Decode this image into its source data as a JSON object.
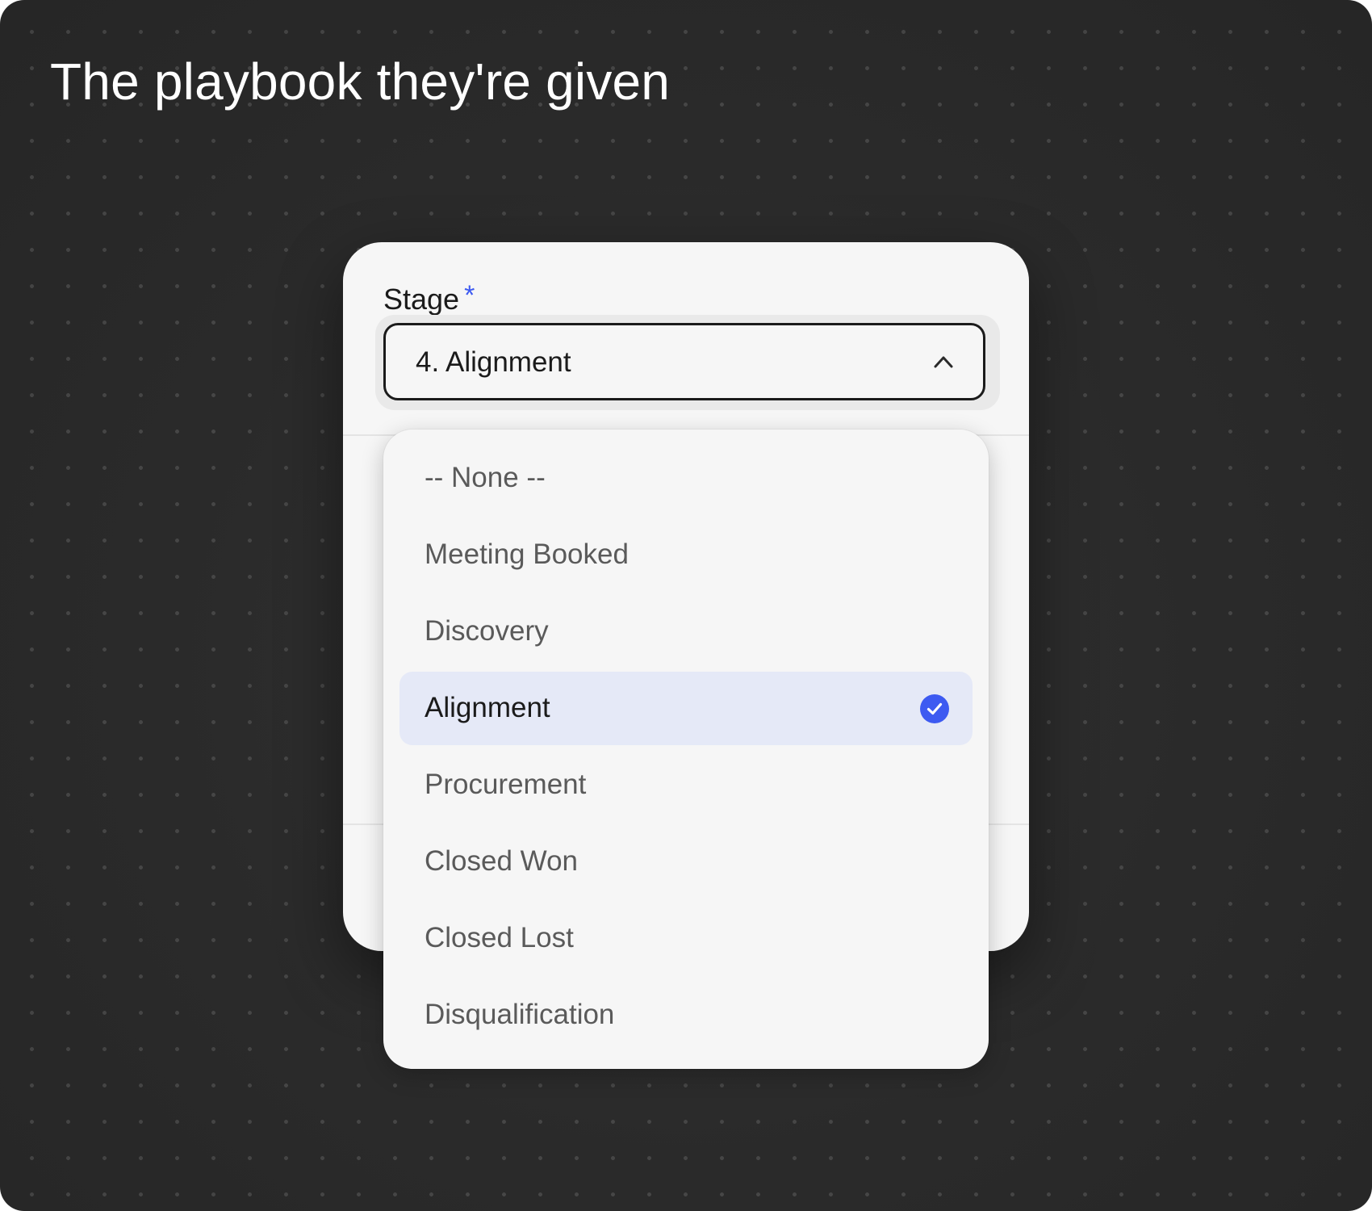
{
  "headline": "The playbook they're given",
  "form": {
    "field_label": "Stage",
    "required_mark": "*",
    "selected_value": "4. Alignment"
  },
  "dropdown": {
    "options": [
      {
        "label": "-- None --",
        "selected": false
      },
      {
        "label": "Meeting Booked",
        "selected": false
      },
      {
        "label": "Discovery",
        "selected": false
      },
      {
        "label": "Alignment",
        "selected": true
      },
      {
        "label": "Procurement",
        "selected": false
      },
      {
        "label": "Closed Won",
        "selected": false
      },
      {
        "label": "Closed Lost",
        "selected": false
      },
      {
        "label": "Disqualification",
        "selected": false
      }
    ]
  },
  "icons": {
    "select_toggle": "chevron-up-icon",
    "selected_marker": "check-circle-icon"
  },
  "colors": {
    "accent": "#3d5af1",
    "selected_row_bg": "#e5e9f7",
    "canvas_bg": "#2b2b2b",
    "card_bg": "#f6f6f6"
  }
}
